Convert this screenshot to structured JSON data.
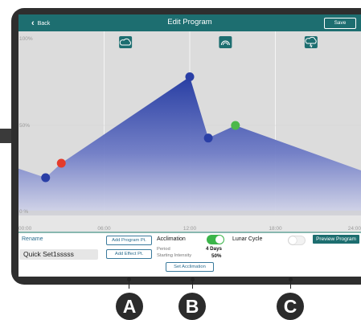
{
  "header": {
    "back_label": "Back",
    "title": "Edit Program",
    "save_label": "Save",
    "color": "#1d6e70"
  },
  "chart_data": {
    "type": "area",
    "x_ticks": [
      "00:00",
      "06:00",
      "12:00",
      "18:00",
      "24:00"
    ],
    "y_ticks": [
      "100%",
      "50%",
      "0 %"
    ],
    "xlim": [
      0,
      24
    ],
    "ylim": [
      0,
      100
    ],
    "grid": true,
    "series": [
      {
        "x": [
          0,
          1.9,
          3.0,
          12.0,
          13.3,
          15.2,
          24
        ],
        "values": [
          26,
          21,
          29,
          77,
          43,
          50,
          25
        ],
        "color": "#3346a8"
      }
    ],
    "points": [
      {
        "x": 1.9,
        "y": 21,
        "color": "#2a3fa6"
      },
      {
        "x": 3.0,
        "y": 29,
        "color": "#e43b2c"
      },
      {
        "x": 12.0,
        "y": 77,
        "color": "#2a3fa6"
      },
      {
        "x": 13.3,
        "y": 43,
        "color": "#2a3fa6"
      },
      {
        "x": 15.2,
        "y": 50,
        "color": "#4cb84a"
      }
    ],
    "effect_icons": [
      {
        "x": 7.5,
        "icon": "cloud-icon"
      },
      {
        "x": 14.5,
        "icon": "rainbow-icon"
      },
      {
        "x": 20.5,
        "icon": "storm-cloud-icon"
      }
    ]
  },
  "panel": {
    "rename_label": "Rename",
    "program_name": "Quick Set1sssss",
    "add_program_pt": "Add Program Pt.",
    "add_effect_pt": "Add Effect Pt.",
    "acclimation_label": "Acclimation",
    "acclimation_on": true,
    "period_label": "Period",
    "period_value": "4 Days",
    "starting_intensity_label": "Starting Intensity",
    "starting_intensity_value": "50%",
    "set_acclimation": "Set Acclimation",
    "lunar_cycle_label": "Lunar Cycle",
    "lunar_cycle_on": false,
    "preview_program": "Preview Program",
    "toggle_on_color": "#3bb54a"
  },
  "callouts": [
    "A",
    "B",
    "C"
  ]
}
